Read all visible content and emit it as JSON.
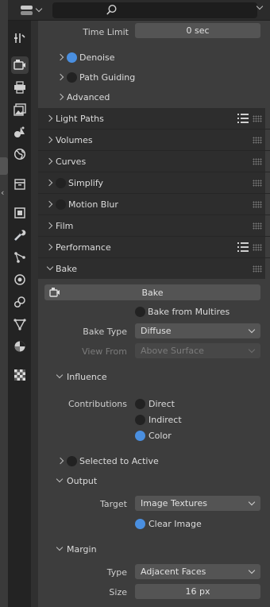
{
  "header": {
    "editor_type_icon": "properties-editor-icon",
    "search_placeholder": "",
    "search_icon": "search-icon"
  },
  "tabs": [
    {
      "name": "tool-tab",
      "icon": "tool-icon",
      "active": false
    },
    {
      "name": "render-tab",
      "icon": "render-camera-icon",
      "active": true
    },
    {
      "name": "output-tab",
      "icon": "printer-icon",
      "active": false
    },
    {
      "name": "view-layer-tab",
      "icon": "image-stack-icon",
      "active": false
    },
    {
      "name": "scene-tab",
      "icon": "scene-icon",
      "active": false
    },
    {
      "name": "world-tab",
      "icon": "world-icon",
      "active": false
    },
    {
      "name": "collection-tab",
      "icon": "collection-box-icon",
      "active": false
    },
    {
      "name": "object-tab",
      "icon": "object-square-icon",
      "active": false
    },
    {
      "name": "modifiers-tab",
      "icon": "wrench-icon",
      "active": false
    },
    {
      "name": "particles-tab",
      "icon": "particles-icon",
      "active": false
    },
    {
      "name": "physics-tab",
      "icon": "physics-icon",
      "active": false
    },
    {
      "name": "constraints-tab",
      "icon": "constraint-icon",
      "active": false
    },
    {
      "name": "data-tab",
      "icon": "mesh-data-icon",
      "active": false
    },
    {
      "name": "material-tab",
      "icon": "material-sphere-icon",
      "active": false
    },
    {
      "name": "texture-tab",
      "icon": "texture-checker-icon",
      "active": false
    }
  ],
  "time_limit": {
    "label": "Time Limit",
    "value": "0 sec"
  },
  "subpanels_top": {
    "denoise": "Denoise",
    "path_guiding": "Path Guiding",
    "advanced": "Advanced"
  },
  "panels": {
    "light_paths": "Light Paths",
    "volumes": "Volumes",
    "curves": "Curves",
    "simplify": "Simplify",
    "motion_blur": "Motion Blur",
    "film": "Film",
    "performance": "Performance",
    "bake": "Bake"
  },
  "bake": {
    "button_label": "Bake",
    "bake_from_multires": "Bake from Multires",
    "bake_type_label": "Bake Type",
    "bake_type_value": "Diffuse",
    "view_from_label": "View From",
    "view_from_value": "Above Surface",
    "influence": {
      "title": "Influence",
      "contributions_label": "Contributions",
      "direct": "Direct",
      "indirect": "Indirect",
      "color": "Color"
    },
    "selected_to_active": "Selected to Active",
    "output": {
      "title": "Output",
      "target_label": "Target",
      "target_value": "Image Textures",
      "clear_image": "Clear Image"
    },
    "margin": {
      "title": "Margin",
      "type_label": "Type",
      "type_value": "Adjacent Faces",
      "size_label": "Size",
      "size_value": "16 px"
    }
  },
  "colors": {
    "accent": "#4a8fe0",
    "panel_header": "#2d2d2d",
    "panel_body": "#3d3d3d",
    "field": "#545454"
  }
}
